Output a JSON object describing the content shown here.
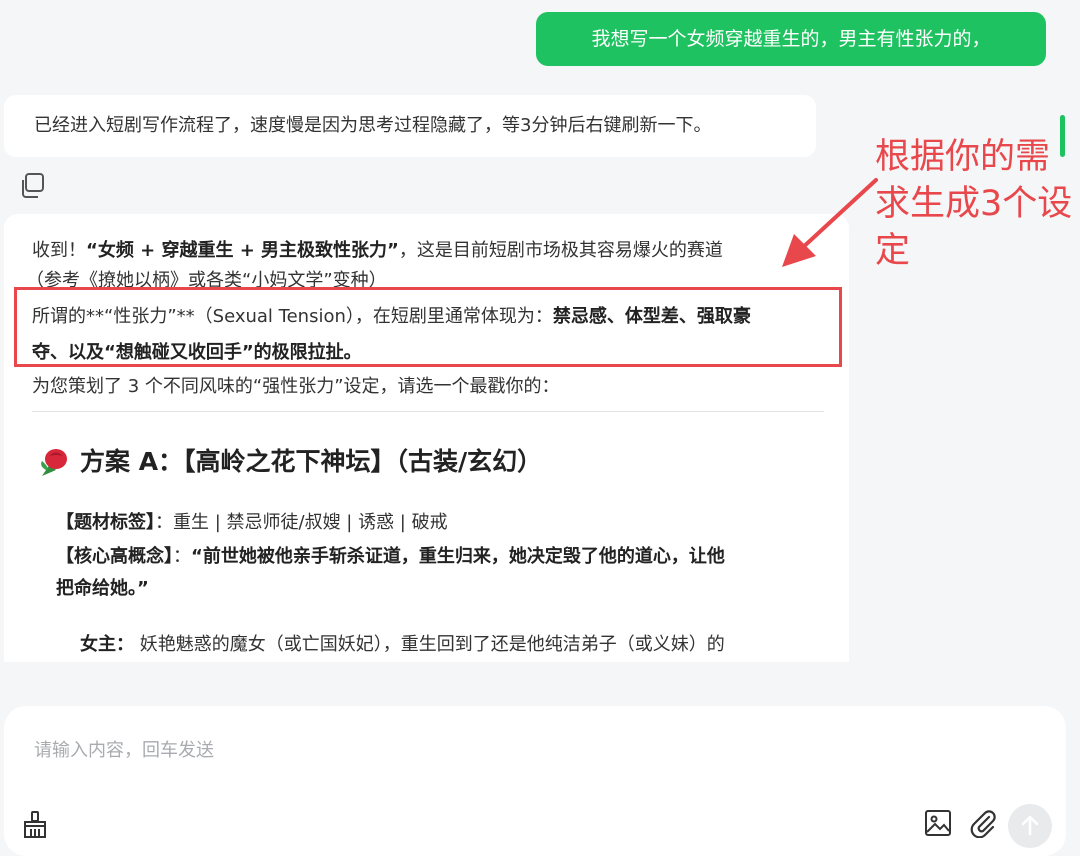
{
  "messages": {
    "user_text": "我想写一个女频穿越重生的，男主有性张力的，",
    "system_text": "已经进入短剧写作流程了，速度慢是因为思考过程隐藏了，等3分钟后右键刷新一下。"
  },
  "annotation": {
    "line1": "根据你的需",
    "line2": "求生成3个设",
    "line3": "定",
    "color": "#e8474b"
  },
  "answer": {
    "p1_a": "收到！",
    "p1_b": "“女频 + 穿越重生 + 男主极致性张力”",
    "p1_c": "，这是目前短剧市场极其容易爆火的赛道",
    "p2": "（参考《撩她以柄》或各类“小妈文学”变种）",
    "p3_a": "所谓的**“性张力”**（Sexual Tension），在短剧里通常体现为：",
    "p3_b": "禁忌感、体型差、强取豪",
    "p4_b": "夺、以及“想触碰又收回手”的极限拉扯。",
    "p5": "为您策划了 3 个不同风味的“强性张力”设定，请选一个最戳你的：",
    "plan_title": "方案 A：【高岭之花下神坛】（古装/玄幻）",
    "tags_label": "【题材标签】",
    "tags_sep": "：",
    "tags_value": "重生 | 禁忌师徒/叔嫂 | 诱惑 | 破戒",
    "concept_label": "【核心高概念】",
    "concept_sep": "：",
    "concept_line1": "“前世她被他亲手斩杀证道，重生归来，她决定毁了他的道心，让他",
    "concept_line2": "把命给她。”",
    "heroine_label": "女主：",
    "heroine_text": "妖艳魅惑的魔女（或亡国妖妃），重生回到了还是他纯洁弟子（或义妹）的"
  },
  "input": {
    "placeholder": "请输入内容，回车发送"
  },
  "icons": {
    "copy": "copy-icon",
    "clear": "broom-icon",
    "image": "image-icon",
    "attach": "paperclip-icon",
    "send": "arrow-up-icon",
    "plan": "rose-icon"
  },
  "colors": {
    "accent": "#1ec260",
    "annotation": "#e8474b"
  }
}
